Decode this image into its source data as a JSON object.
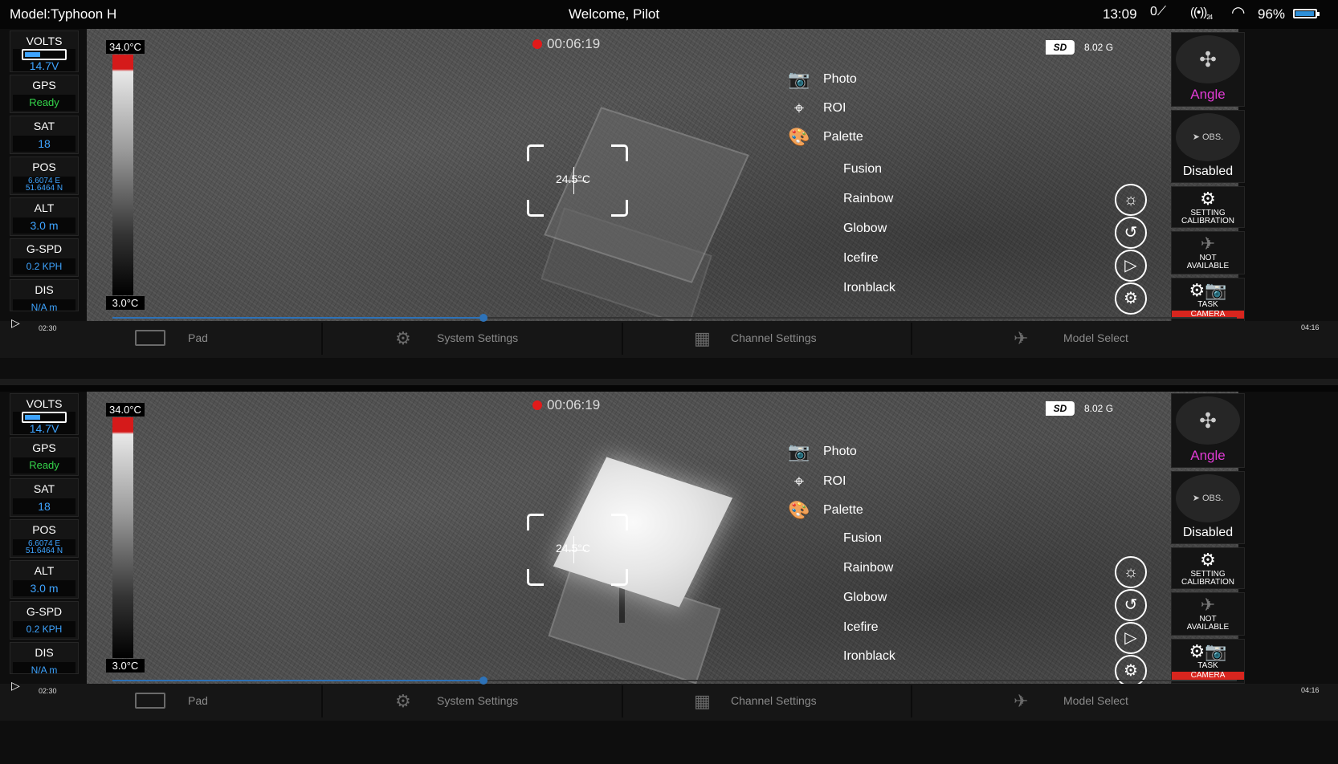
{
  "topbar": {
    "model": "Model:Typhoon H",
    "welcome": "Welcome, Pilot",
    "time": "13:09",
    "signal": "0",
    "rc": "24",
    "battery_pct": "96%",
    "battery_level": 0.96
  },
  "sidebar": {
    "volts": {
      "label": "VOLTS",
      "value": "14.7V",
      "level": 0.4
    },
    "gps": {
      "label": "GPS",
      "value": "Ready"
    },
    "sat": {
      "label": "SAT",
      "value": "18"
    },
    "pos": {
      "label": "POS",
      "lon": "6.6074 E",
      "lat": "51.6464 N"
    },
    "alt": {
      "label": "ALT",
      "value": "3.0 m"
    },
    "gspd": {
      "label": "G-SPD",
      "value": "0.2 KPH"
    },
    "dis": {
      "label": "DIS",
      "value": "N/A m"
    }
  },
  "scale": {
    "max": "34.0°C",
    "min": "3.0°C"
  },
  "recording": {
    "time": "00:06:19"
  },
  "storage": {
    "card": "SD",
    "capacity": "8.02 G"
  },
  "spot_temp": "24.5°C",
  "menu": {
    "photo": "Photo",
    "roi": "ROI",
    "palette": "Palette",
    "palettes": [
      "Fusion",
      "Rainbow",
      "Globow",
      "Icefire",
      "Ironblack"
    ]
  },
  "right_panel": {
    "mode": "Angle",
    "obs_caption": "OBS.",
    "obs_status": "Disabled",
    "setting_line1": "SETTING",
    "setting_line2": "CALIBRATION",
    "na_line1": "NOT",
    "na_line2": "AVAILABLE",
    "task": "TASK",
    "camera": "CAMERA"
  },
  "playback": {
    "current": "02:30",
    "end": "04:16",
    "progress": 0.33
  },
  "nav": {
    "pad": "Pad",
    "system": "System Settings",
    "channel": "Channel Settings",
    "model": "Model Select"
  },
  "colors": {
    "accent_blue": "#3ea4ff",
    "ready_green": "#34d34a",
    "mode_magenta": "#e23bd6",
    "rec_red": "#e21a1a"
  }
}
